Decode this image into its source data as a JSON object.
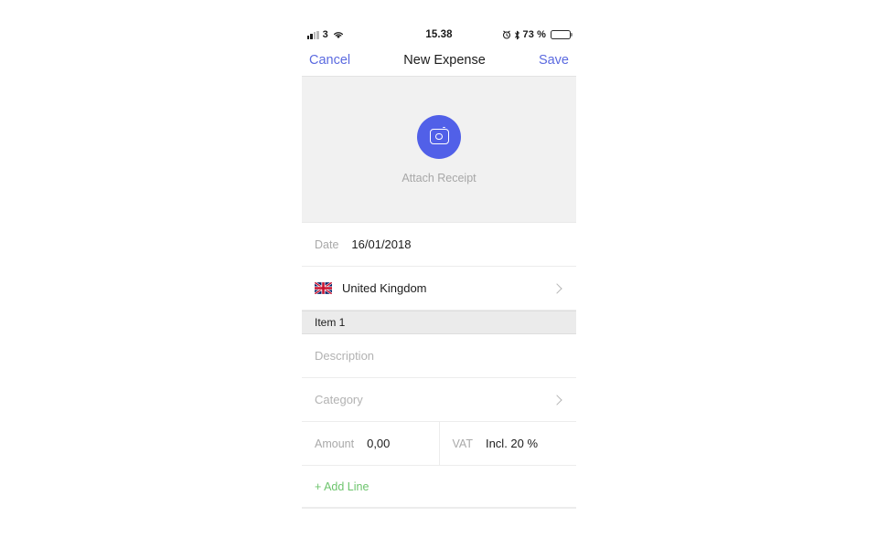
{
  "status_bar": {
    "carrier": "3",
    "wifi_icon": "wifi-icon",
    "time": "15.38",
    "alarm_icon": "alarm-clock-icon",
    "bluetooth_icon": "bluetooth-icon",
    "battery_percent": "73 %",
    "battery_level": 73
  },
  "nav_bar": {
    "cancel_label": "Cancel",
    "title": "New Expense",
    "save_label": "Save",
    "link_color": "#5b6ae0"
  },
  "receipt": {
    "icon": "camera-icon",
    "label": "Attach Receipt",
    "circle_color": "#5160e8",
    "zone_color": "#f1f1f1"
  },
  "form": {
    "date": {
      "label": "Date",
      "value": "16/01/2018"
    },
    "country": {
      "flag_icon": "united-kingdom-flag-icon",
      "value": "United Kingdom",
      "chevron": "chevron-right-icon"
    },
    "section": {
      "title": "Item 1"
    },
    "description": {
      "placeholder": "Description",
      "value": ""
    },
    "category": {
      "placeholder": "Category",
      "value": "",
      "chevron": "chevron-right-icon"
    },
    "amount": {
      "label": "Amount",
      "value": "0,00"
    },
    "vat": {
      "label": "VAT",
      "value": "Incl. 20 %"
    },
    "add_line": {
      "label": "+ Add Line",
      "color": "#6cc46c"
    }
  }
}
